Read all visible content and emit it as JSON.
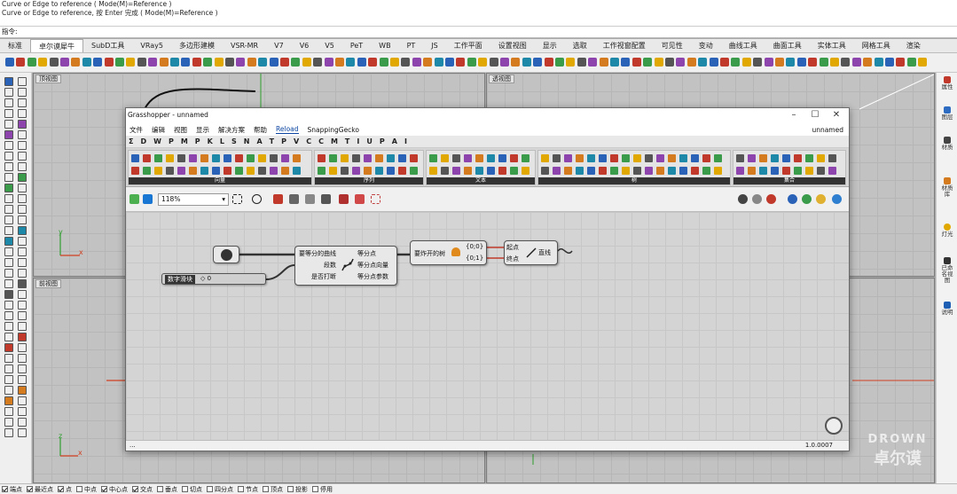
{
  "command_history": [
    "Curve or Edge to reference ( Mode(M)=Reference )",
    "Curve or Edge to reference, 按 Enter 完成 ( Mode(M)=Reference )"
  ],
  "command_prompt": "指令:",
  "rhino_tabs": [
    "标准",
    "卓尔谟犀牛",
    "SubD工具",
    "VRay5",
    "多边形建模",
    "VSR-MR",
    "V7",
    "V6",
    "V5",
    "PeT",
    "WB",
    "PT",
    "JS",
    "工作平面",
    "设置视图",
    "显示",
    "选取",
    "工作视窗配置",
    "可见性",
    "变动",
    "曲线工具",
    "曲面工具",
    "实体工具",
    "网格工具",
    "渲染"
  ],
  "active_rhino_tab": "卓尔谟犀牛",
  "viewports": {
    "top": "顶视图",
    "perspective": "透视图",
    "front": "前视图"
  },
  "right_panel": [
    "属性",
    "图层",
    "材质",
    "材质库",
    "灯光",
    "已命名视图",
    "说明"
  ],
  "osnaps": [
    {
      "label": "端点",
      "on": true
    },
    {
      "label": "最近点",
      "on": true
    },
    {
      "label": "点",
      "on": true
    },
    {
      "label": "中点",
      "on": false
    },
    {
      "label": "中心点",
      "on": true
    },
    {
      "label": "交点",
      "on": true
    },
    {
      "label": "垂点",
      "on": false
    },
    {
      "label": "切点",
      "on": false
    },
    {
      "label": "四分点",
      "on": false
    },
    {
      "label": "节点",
      "on": false
    },
    {
      "label": "顶点",
      "on": false
    },
    {
      "label": "投影",
      "on": false
    },
    {
      "label": "停用",
      "on": false
    }
  ],
  "grasshopper": {
    "title": "Grasshopper - unnamed",
    "document": "unnamed",
    "menu": [
      "文件",
      "编辑",
      "视图",
      "显示",
      "解决方案",
      "帮助",
      "Reload",
      "SnappingGecko"
    ],
    "categories": [
      "Σ",
      "D",
      "W",
      "P",
      "M",
      "P",
      "K",
      "L",
      "S",
      "N",
      "A",
      "T",
      "P",
      "V",
      "C",
      "C",
      "M",
      "T",
      "I",
      "U",
      "P",
      "A",
      "I"
    ],
    "panel_labels": [
      "向量",
      "序列",
      "文本",
      "树",
      "集合"
    ],
    "zoom": "118%",
    "version": "1.0.0007",
    "status_left": "...",
    "components": {
      "divide_curve": {
        "inputs": [
          "要等分的曲线",
          "段数",
          "是否打断"
        ],
        "outputs": [
          "等分点",
          "等分点向量",
          "等分点参数"
        ]
      },
      "slider": {
        "label": "数字滑块",
        "value": "◇ 0"
      },
      "tree": {
        "label": "要炸开的树",
        "out1": "{0;0}",
        "out2": "{0;1}"
      },
      "line": {
        "inputs": [
          "起点",
          "终点"
        ],
        "label": "直线"
      }
    }
  },
  "watermark": {
    "line1": "DROWN",
    "line2": "卓尔谟"
  },
  "colors": {
    "wire": "#333333",
    "alert": "#c0392b",
    "axis_x": "#d04020",
    "axis_y": "#2e9e2e",
    "accent": "#0078d7"
  }
}
